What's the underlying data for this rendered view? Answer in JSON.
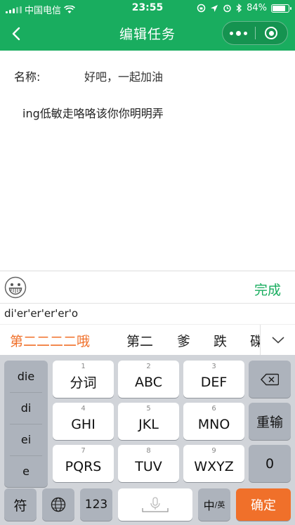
{
  "status_bar": {
    "carrier": "中国电信",
    "time": "23:55",
    "battery": "84%",
    "battery_level": 0.84
  },
  "nav": {
    "title": "编辑任务"
  },
  "form": {
    "name_label": "名称:",
    "name_value": "好吧，一起加油",
    "description": "ing低敏走咯咯该你你明明弄"
  },
  "toolbar": {
    "done_label": "完成"
  },
  "ime": {
    "composition": "di'er'er'er'er'o",
    "candidates": [
      "第二二二二哦",
      "第二",
      "爹",
      "跌",
      "碟"
    ]
  },
  "keyboard": {
    "pinyin_options": [
      "die",
      "di",
      "ei",
      "e"
    ],
    "row1": [
      {
        "num": "1",
        "label": "分词"
      },
      {
        "num": "2",
        "label": "ABC"
      },
      {
        "num": "3",
        "label": "DEF"
      }
    ],
    "row2": [
      {
        "num": "4",
        "label": "GHI"
      },
      {
        "num": "5",
        "label": "JKL"
      },
      {
        "num": "6",
        "label": "MNO"
      }
    ],
    "row3": [
      {
        "num": "7",
        "label": "PQRS"
      },
      {
        "num": "8",
        "label": "TUV"
      },
      {
        "num": "9",
        "label": "WXYZ"
      }
    ],
    "reinput": "重输",
    "zero": "0",
    "symbol": "符",
    "num_switch": "123",
    "lang_main": "中",
    "lang_sub": "/英",
    "confirm": "确定"
  },
  "colors": {
    "brand_green": "#19ad5f",
    "accent_orange": "#f0702a"
  }
}
